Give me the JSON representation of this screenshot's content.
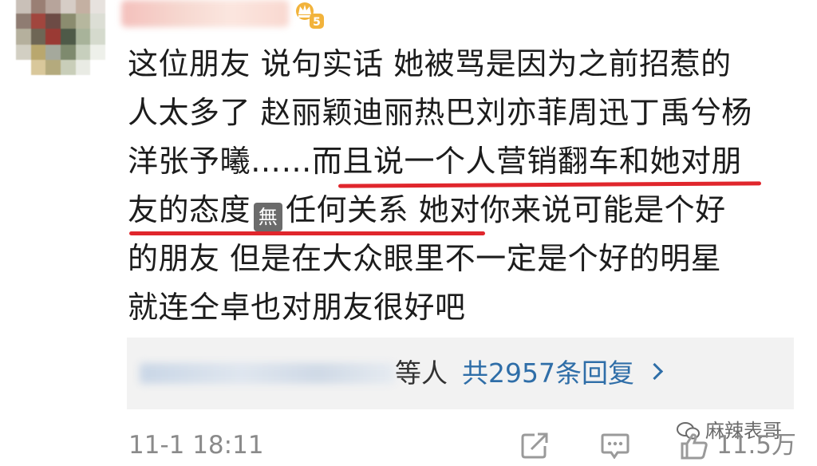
{
  "comment": {
    "lines": [
      "这位朋友  说句实话  她被骂是因为之前招惹的",
      "人太多了  赵丽颖迪丽热巴刘亦菲周迅丁禹兮杨",
      "洋张予曦……而且说一个人营销翻车和她对朋",
      "友的态度",
      "任何关系  她对你来说可能是个好",
      "的朋友  但是在大众眼里不一定是个好的明星",
      "就连仝卓也对朋友很好吧"
    ],
    "emoji_label": "無"
  },
  "replies": {
    "people_suffix": "等人",
    "count_label": "共2957条回复"
  },
  "footer": {
    "timestamp": "11-1 18:11",
    "watermark": "麻辣表哥",
    "like_count": "11.5万"
  },
  "colors": {
    "accent_link": "#2f6ea8",
    "underline": "#e0262c",
    "reply_bg": "#f2f2f2",
    "meta_text": "#8a8a8a"
  },
  "icons": [
    "vip-crown-icon",
    "chevron-right-icon",
    "share-icon",
    "comment-icon",
    "like-icon",
    "wechat-icon"
  ]
}
